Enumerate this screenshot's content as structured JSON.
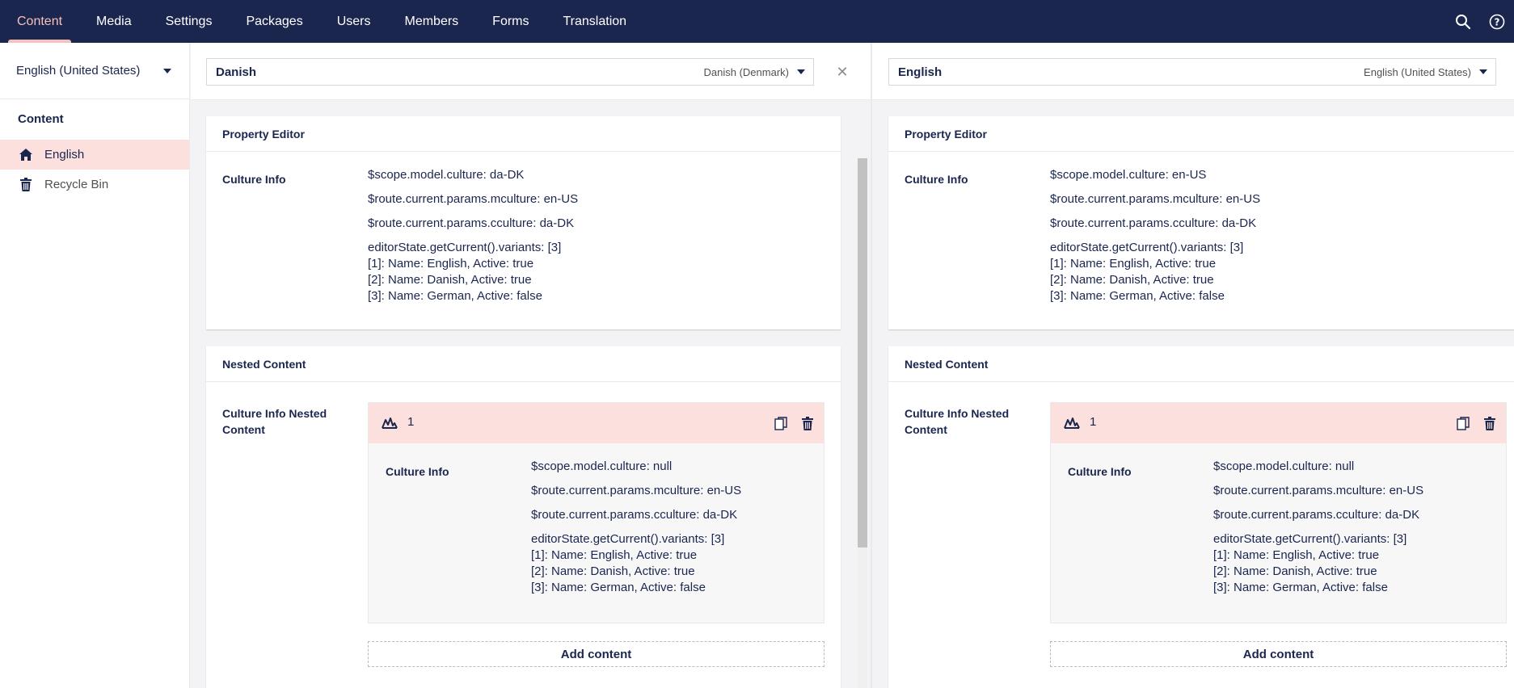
{
  "topnav": {
    "items": [
      "Content",
      "Media",
      "Settings",
      "Packages",
      "Users",
      "Members",
      "Forms",
      "Translation"
    ],
    "active": "Content",
    "icons": [
      "search-icon",
      "help-icon"
    ]
  },
  "sidebar": {
    "language": "English (United States)",
    "tree_root": "Content",
    "items": [
      {
        "label": "English",
        "icon": "home-icon",
        "active": true
      },
      {
        "label": "Recycle Bin",
        "icon": "trash-icon",
        "active": false
      }
    ]
  },
  "colors": {
    "topbar": "#1b264f",
    "accent": "#f5c1bc",
    "active_bg": "#fbe0dd"
  },
  "panes": {
    "left": {
      "variant_name": "Danish",
      "variant_culture": "Danish (Denmark)",
      "property_editor": {
        "title": "Property Editor",
        "label": "Culture Info",
        "lines": [
          "$scope.model.culture: da-DK",
          "$route.current.params.mculture: en-US",
          "$route.current.params.cculture: da-DK"
        ],
        "variants_lines": [
          "editorState.getCurrent().variants: [3]",
          "[1]: Name: English, Active: true",
          "[2]: Name: Danish, Active: true",
          "[3]: Name: German, Active: false"
        ]
      },
      "nested_content": {
        "title": "Nested Content",
        "label_line1": "Culture Info Nested",
        "label_line2": "Content",
        "item_title": "1",
        "item_label": "Culture Info",
        "lines": [
          "$scope.model.culture: null",
          "$route.current.params.mculture: en-US",
          "$route.current.params.cculture: da-DK"
        ],
        "variants_lines": [
          "editorState.getCurrent().variants: [3]",
          "[1]: Name: English, Active: true",
          "[2]: Name: Danish, Active: true",
          "[3]: Name: German, Active: false"
        ],
        "add_label": "Add content"
      }
    },
    "right": {
      "variant_name": "English",
      "variant_culture": "English (United States)",
      "property_editor": {
        "title": "Property Editor",
        "label": "Culture Info",
        "lines": [
          "$scope.model.culture: en-US",
          "$route.current.params.mculture: en-US",
          "$route.current.params.cculture: da-DK"
        ],
        "variants_lines": [
          "editorState.getCurrent().variants: [3]",
          "[1]: Name: English, Active: true",
          "[2]: Name: Danish, Active: true",
          "[3]: Name: German, Active: false"
        ]
      },
      "nested_content": {
        "title": "Nested Content",
        "label_line1": "Culture Info Nested",
        "label_line2": "Content",
        "item_title": "1",
        "item_label": "Culture Info",
        "lines": [
          "$scope.model.culture: null",
          "$route.current.params.mculture: en-US",
          "$route.current.params.cculture: da-DK"
        ],
        "variants_lines": [
          "editorState.getCurrent().variants: [3]",
          "[1]: Name: English, Active: true",
          "[2]: Name: Danish, Active: true",
          "[3]: Name: German, Active: false"
        ],
        "add_label": "Add content"
      }
    }
  }
}
